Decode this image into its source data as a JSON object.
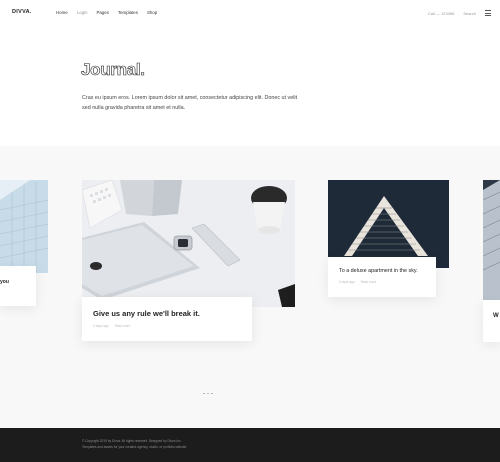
{
  "header": {
    "logo": "DIVVA.",
    "nav": [
      "Home",
      "Login",
      "Pages",
      "Templates",
      "Shop"
    ],
    "right_links": [
      "Call — 123456",
      "Search"
    ]
  },
  "hero": {
    "title": "Journal.",
    "description": "Cras eu ipsum eros. Lorem ipsum dolor sit amet, consectetur adipiscing elit. Donec ut velit sed nulla gravida pharetra sit amet et nulla."
  },
  "posts": [
    {
      "title": "you",
      "meta": [
        "",
        ""
      ]
    },
    {
      "title": "Give us any rule we'll break it.",
      "meta": [
        "2 days ago",
        "Read more"
      ]
    },
    {
      "title": "To a deluxe apartment in the sky.",
      "meta": [
        "2 days ago",
        "Read more"
      ]
    },
    {
      "title": "W",
      "meta": [
        "",
        ""
      ]
    }
  ],
  "footer": {
    "line1": "© Copyright 2019 by Divva. All rights reserved. Designed by Divva Inc.",
    "line2": "Templates and assets for your creative agency, studio, or portfolio website."
  },
  "colors": {
    "footer_bg": "#1c1c1c",
    "band_bg": "#f8f8f8",
    "accent_dark": "#1f2a38"
  }
}
